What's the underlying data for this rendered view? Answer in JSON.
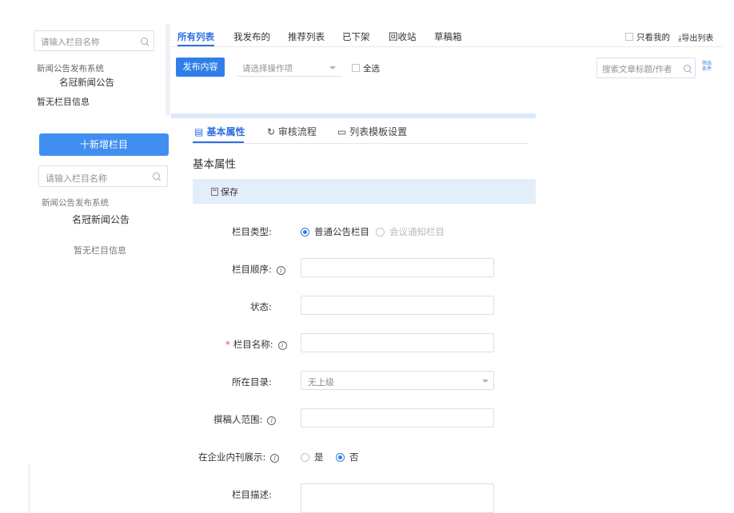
{
  "bg": {
    "sidebar": {
      "search_placeholder": "请输入栏目名称",
      "tree_root": "新闻公告发布系统",
      "tree_child": "名冠新闻公告",
      "empty": "暂无栏目信息"
    },
    "tabs": [
      "所有列表",
      "我发布的",
      "推荐列表",
      "已下架",
      "回收站",
      "草稿箱"
    ],
    "only_mine": "只看我的",
    "export": "导出列表",
    "publish_button": "发布内容",
    "operation_placeholder": "请选择操作项",
    "select_all": "全选",
    "article_search_placeholder": "搜索文章标题/作者",
    "filter_label": "筛选条件"
  },
  "fg": {
    "sidebar": {
      "new_button": "十新增栏目",
      "search_placeholder": "请输入栏目名称",
      "tree_root": "新闻公告发布系统",
      "tree_child": "名冠新闻公告",
      "empty": "暂无栏目信息"
    },
    "tabs": {
      "basic": "基本属性",
      "review": "审核流程",
      "template": "列表模板设置"
    },
    "section_title": "基本属性",
    "save_label": "保存",
    "form": {
      "type_label": "栏目类型:",
      "type_option_1": "普通公告栏目",
      "type_option_2": "会议通知栏目",
      "order_label": "栏目顺序:",
      "status_label": "状态:",
      "name_label": "栏目名称:",
      "dir_label": "所在目录:",
      "dir_value": "无上级",
      "author_scope_label": "撰稿人范围:",
      "intranet_label": "在企业内刊展示:",
      "yes": "是",
      "no": "否",
      "desc_label": "栏目描述:",
      "required_mark": "*",
      "info_glyph": "i"
    }
  },
  "colors": {
    "primary": "#2f7fe8",
    "active_tab": "#2f6fe2",
    "save_bar": "#e3eefb",
    "required": "#e34a4a"
  }
}
